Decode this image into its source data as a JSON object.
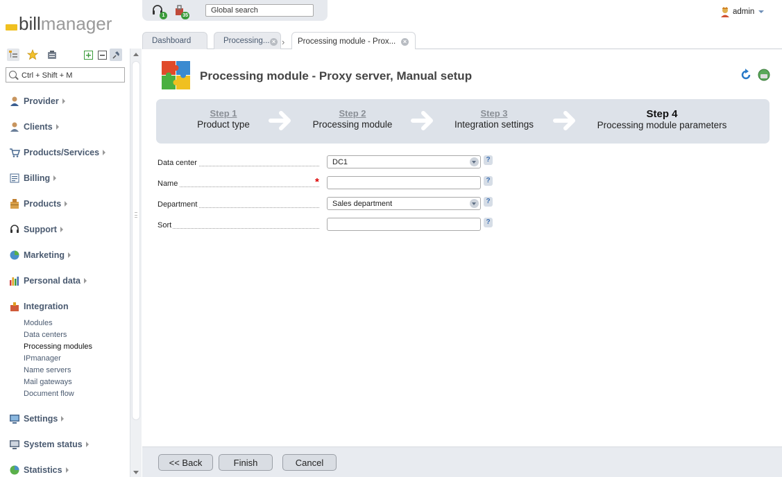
{
  "brand": {
    "part1": "bill",
    "part2": "manager"
  },
  "topbar": {
    "headset_count": "1",
    "bag_count": "35",
    "search_placeholder": "Global search"
  },
  "user": {
    "name": "admin"
  },
  "sidebar": {
    "search_placeholder": "Ctrl + Shift + M",
    "items": [
      {
        "label": "Provider"
      },
      {
        "label": "Clients"
      },
      {
        "label": "Products/Services"
      },
      {
        "label": "Billing"
      },
      {
        "label": "Products"
      },
      {
        "label": "Support"
      },
      {
        "label": "Marketing"
      },
      {
        "label": "Personal data"
      },
      {
        "label": "Integration"
      },
      {
        "label": "Settings"
      },
      {
        "label": "System status"
      },
      {
        "label": "Statistics"
      }
    ],
    "integration_sub": [
      "Modules",
      "Data centers",
      "Processing modules",
      "IPmanager",
      "Name servers",
      "Mail gateways",
      "Document flow"
    ]
  },
  "tabs": [
    {
      "label": "Dashboard"
    },
    {
      "label": "Processing..."
    },
    {
      "label": "Processing module - Prox..."
    }
  ],
  "page": {
    "title": "Processing module - Proxy server, Manual setup"
  },
  "steps": [
    {
      "num": "Step 1",
      "label": "Product type"
    },
    {
      "num": "Step 2",
      "label": "Processing module"
    },
    {
      "num": "Step 3",
      "label": "Integration settings"
    },
    {
      "num": "Step 4",
      "label": "Processing module parameters"
    }
  ],
  "form": {
    "data_center": {
      "label": "Data center",
      "value": "DC1"
    },
    "name": {
      "label": "Name",
      "value": ""
    },
    "department": {
      "label": "Department",
      "value": "Sales department"
    },
    "sort": {
      "label": "Sort",
      "value": ""
    },
    "help": "?",
    "required_mark": "*"
  },
  "footer": {
    "back": "<< Back",
    "finish": "Finish",
    "cancel": "Cancel"
  },
  "colors": {
    "accent": "#4a5a70",
    "logo_mark": "#f0c020",
    "required": "#dd0000",
    "badge": "#3a9a3a"
  }
}
